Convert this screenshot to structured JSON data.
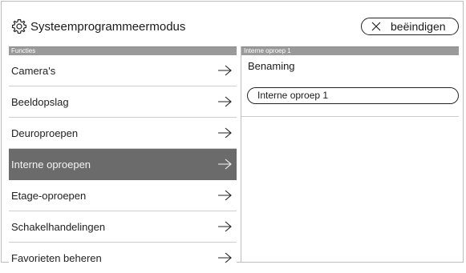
{
  "header": {
    "title": "Systeemprogrammeermodus",
    "end_label": "beëindigen",
    "settings_icon": "gear-icon",
    "close_icon": "close-icon"
  },
  "left": {
    "heading": "Functies",
    "items": [
      {
        "label": "Camera's"
      },
      {
        "label": "Beeldopslag"
      },
      {
        "label": "Deuroproepen"
      },
      {
        "label": "Interne oproepen",
        "active": true
      },
      {
        "label": "Etage-oproepen"
      },
      {
        "label": "Schakelhandelingen"
      },
      {
        "label": "Favorieten beheren"
      }
    ],
    "item_icon": "arrow-right-icon"
  },
  "right": {
    "heading": "Interne oproep 1",
    "field_label": "Benaming",
    "field_value": "Interne oproep 1"
  },
  "colors": {
    "active_bg": "#6b6b6b",
    "heading_bg": "#9a9a9a"
  }
}
